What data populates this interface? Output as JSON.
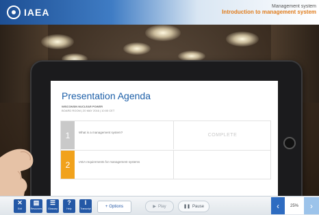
{
  "header": {
    "logo_text": "IAEA",
    "course_category": "Management system",
    "course_title": "Introduction to management system"
  },
  "slide": {
    "title": "Presentation Agenda",
    "subtitle_line1": "WISCONSIN NUCLEAR POWER",
    "subtitle_line2": "BOARD ROOM | 20 MAY 2016 | 10:00 CET",
    "agenda": [
      {
        "number": "1",
        "text": "What is a management system?",
        "status": "COMPLETE",
        "color": "#c9c9c9"
      },
      {
        "number": "2",
        "text": "IAEA requirements for management systems",
        "status": "",
        "color": "#f1a21c"
      }
    ]
  },
  "toolbar": {
    "tools": [
      {
        "icon": "exit-icon",
        "glyph": "✕",
        "label": "Exit"
      },
      {
        "icon": "resources-icon",
        "glyph": "▤",
        "label": "Resources"
      },
      {
        "icon": "glossary-icon",
        "glyph": "☰",
        "label": "Glossary"
      },
      {
        "icon": "help-icon",
        "glyph": "?",
        "label": "Help"
      },
      {
        "icon": "transcript-icon",
        "glyph": "I",
        "label": "Transcript"
      }
    ],
    "options_label": "Options",
    "play_label": "Play",
    "pause_label": "Pause",
    "progress": "25%"
  },
  "colors": {
    "brand_blue": "#2458a6",
    "accent_orange": "#e07b1a"
  }
}
